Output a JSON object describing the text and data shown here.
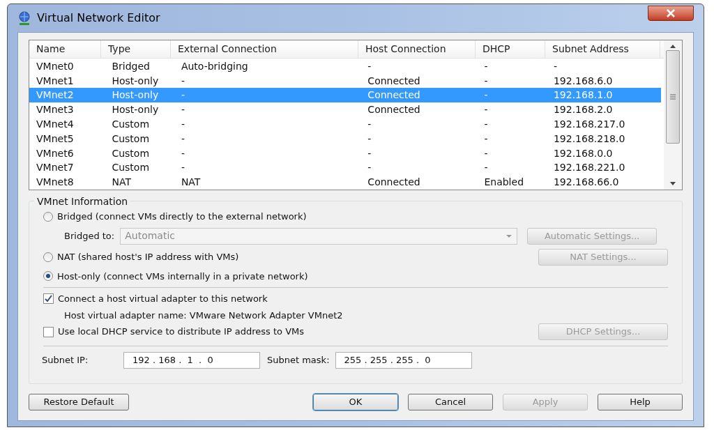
{
  "window": {
    "title": "Virtual Network Editor"
  },
  "table": {
    "columns": [
      "Name",
      "Type",
      "External Connection",
      "Host Connection",
      "DHCP",
      "Subnet Address"
    ],
    "rows": [
      {
        "cells": [
          "VMnet0",
          "Bridged",
          "Auto-bridging",
          "-",
          "-",
          "-"
        ],
        "selected": false
      },
      {
        "cells": [
          "VMnet1",
          "Host-only",
          "-",
          "Connected",
          "-",
          "192.168.6.0"
        ],
        "selected": false
      },
      {
        "cells": [
          "VMnet2",
          "Host-only",
          "-",
          "Connected",
          "-",
          "192.168.1.0"
        ],
        "selected": true
      },
      {
        "cells": [
          "VMnet3",
          "Host-only",
          "-",
          "Connected",
          "-",
          "192.168.2.0"
        ],
        "selected": false
      },
      {
        "cells": [
          "VMnet4",
          "Custom",
          "-",
          "-",
          "-",
          "192.168.217.0"
        ],
        "selected": false
      },
      {
        "cells": [
          "VMnet5",
          "Custom",
          "-",
          "-",
          "-",
          "192.168.218.0"
        ],
        "selected": false
      },
      {
        "cells": [
          "VMnet6",
          "Custom",
          "-",
          "-",
          "-",
          "192.168.0.0"
        ],
        "selected": false
      },
      {
        "cells": [
          "VMnet7",
          "Custom",
          "-",
          "-",
          "-",
          "192.168.221.0"
        ],
        "selected": false
      },
      {
        "cells": [
          "VMnet8",
          "NAT",
          "NAT",
          "Connected",
          "Enabled",
          "192.168.66.0"
        ],
        "selected": false
      }
    ]
  },
  "vmnet_information": {
    "title": "VMnet Information",
    "bridged": {
      "label": "Bridged (connect VMs directly to the external network)",
      "selected": false
    },
    "bridged_to": {
      "label": "Bridged to:",
      "value": "Automatic",
      "disabled": true
    },
    "automatic_settings": {
      "label": "Automatic Settings...",
      "disabled": true
    },
    "nat": {
      "label": "NAT (shared host's IP address with VMs)",
      "selected": false
    },
    "nat_settings": {
      "label": "NAT Settings...",
      "disabled": true
    },
    "host_only": {
      "label": "Host-only (connect VMs internally in a private network)",
      "selected": true
    },
    "connect_adapter": {
      "label": "Connect a host virtual adapter to this network",
      "checked": true
    },
    "adapter_name": "Host virtual adapter name: VMware Network Adapter VMnet2",
    "use_dhcp": {
      "label": "Use local DHCP service to distribute IP address to VMs",
      "checked": false
    },
    "dhcp_settings": {
      "label": "DHCP Settings...",
      "disabled": true
    },
    "subnet_ip": {
      "label": "Subnet IP:",
      "value": "192 . 168 .  1  .  0"
    },
    "subnet_mask": {
      "label": "Subnet mask:",
      "value": "255 . 255 . 255 .  0"
    }
  },
  "buttons": [
    {
      "label": "Restore Default",
      "disabled": false,
      "default": false
    },
    {
      "label": "OK",
      "disabled": false,
      "default": true
    },
    {
      "label": "Cancel",
      "disabled": false,
      "default": false
    },
    {
      "label": "Apply",
      "disabled": true,
      "default": false
    },
    {
      "label": "Help",
      "disabled": false,
      "default": false
    }
  ]
}
